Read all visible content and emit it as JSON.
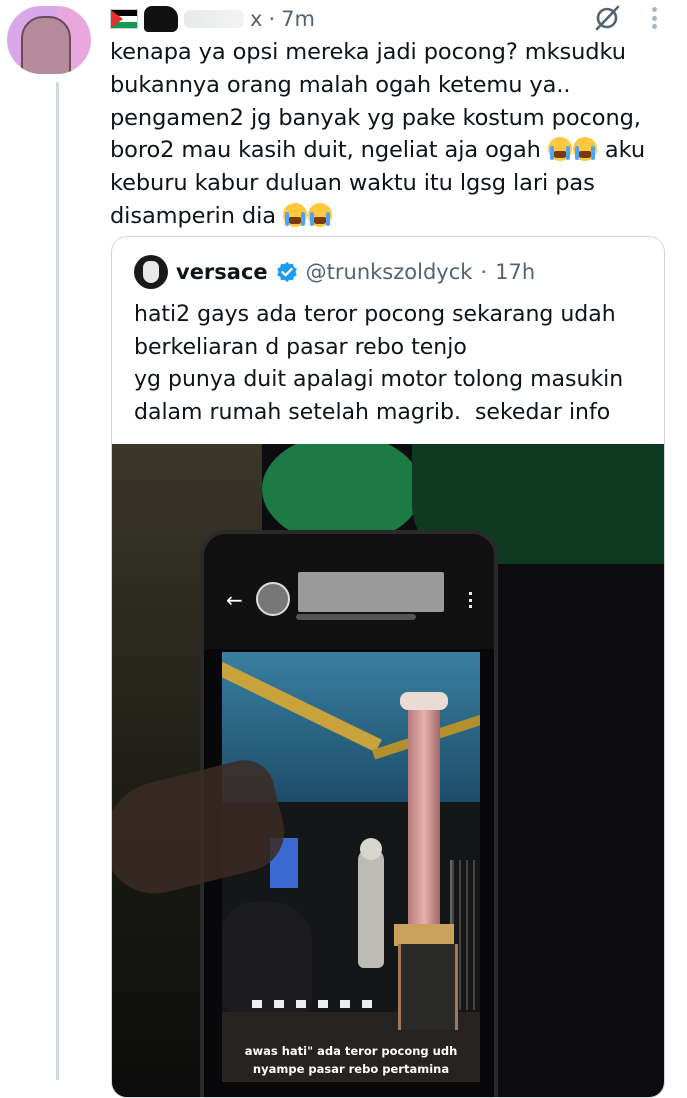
{
  "reply": {
    "handle_visible": "x",
    "time": "7m",
    "text": "kenapa ya opsi mereka jadi pocong? mksudku\nbukannya orang malah ogah ketemu ya..\npengamen2 jg banyak yg pake kostum pocong,\nboro2 mau kasih duit, ngeliat aja ogah ",
    "text_mid": " aku\nkeburu kabur duluan waktu itu lgsg lari pas\ndisamperin dia ",
    "icons": [
      "palestine-flag",
      "grok-icon",
      "more-icon",
      "loudly-crying-emoji"
    ]
  },
  "quoted": {
    "name": "versace",
    "handle": "@trunkszoldyck",
    "time": "17h",
    "separator": "·",
    "text": "hati2 gays ada teror pocong sekarang udah\nberkeliaran d pasar rebo tenjo\nyg punya duit apalagi motor tolong masukin\ndalam rumah setelah magrib.  sekedar info",
    "media": {
      "caption_line1": "awas hati\" ada teror  pocong udh",
      "caption_line2": "nyampe pasar rebo pertamina"
    }
  },
  "colors": {
    "text": "#0f1419",
    "secondary": "#536471",
    "border": "#cfd9de",
    "verified": "#1d9bf0"
  }
}
